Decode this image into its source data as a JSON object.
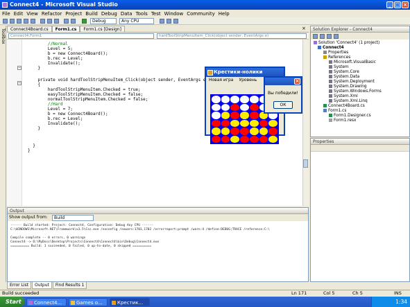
{
  "window": {
    "title": "Connect4 - Microsoft Visual Studio"
  },
  "menu": [
    "File",
    "Edit",
    "View",
    "Refactor",
    "Project",
    "Build",
    "Debug",
    "Data",
    "Tools",
    "Test",
    "Window",
    "Community",
    "Help"
  ],
  "toolbar": {
    "config": "Debug",
    "platform": "Any CPU"
  },
  "left_tab": "Toolbox",
  "doc_tabs": [
    "Connect4Board.cs",
    "Form1.cs",
    "Form1.cs [Design]"
  ],
  "nav": {
    "class": "Connect4.Form1",
    "member": "hardToolStripMenuItem_Click(object sender, EventArgs e)"
  },
  "code_lines": [
    "        //Normal",
    "        Level = 5;",
    "        b = new Connect4Board();",
    "        b.rec = Level;",
    "        Invalidate();",
    "    }",
    "",
    "    private void hardToolStripMenuItem_Click(object sender, EventArgs e)",
    "    {",
    "        hardToolStripMenuItem.Checked = true;",
    "        easyToolStripMenuItem.Checked = false;",
    "        normalToolStripMenuItem.Checked = false;",
    "        //Hard",
    "        Level = 7;",
    "        b = new Connect4Board();",
    "        b.rec = Level;",
    "        Invalidate();",
    "    }",
    "",
    "  }",
    "}"
  ],
  "solution_explorer": {
    "title": "Solution Explorer - Connect4",
    "nodes": [
      "Solution 'Connect4' (1 project)",
      "Connect4",
      "Properties",
      "References",
      "Microsoft.VisualBasic",
      "System",
      "System.Core",
      "System.Data",
      "System.Deployment",
      "System.Drawing",
      "System.Windows.Forms",
      "System.Xml",
      "System.Xml.Linq",
      "Connect4Board.cs",
      "Form1.cs",
      "Form1.Designer.cs",
      "Form1.resx"
    ]
  },
  "properties": {
    "title": "Properties"
  },
  "game_window": {
    "title": "Крестики-нолики",
    "menu": [
      "Новая игра",
      "Уровень"
    ],
    "board": [
      [
        "white",
        "white",
        "white",
        "white",
        "white",
        "white",
        "white"
      ],
      [
        "white",
        "white",
        "red",
        "white",
        "red",
        "white",
        "white"
      ],
      [
        "white",
        "yellow",
        "red",
        "yellow",
        "red",
        "yellow",
        "white"
      ],
      [
        "red",
        "red",
        "yellow",
        "yellow",
        "yellow",
        "red",
        "yellow"
      ],
      [
        "yellow",
        "yellow",
        "red",
        "red",
        "yellow",
        "yellow",
        "red"
      ],
      [
        "red",
        "red",
        "yellow",
        "red",
        "red",
        "red",
        "yellow"
      ]
    ]
  },
  "message_box": {
    "text": "Вы победили!",
    "ok": "ОК"
  },
  "output": {
    "title": "Output",
    "show_label": "Show output from:",
    "source": "Build",
    "lines": [
      "------ Build started: Project: Connect4, Configuration: Debug Any CPU ------",
      "C:\\WINDOWS\\Microsoft.NET\\Framework\\v3.5\\Csc.exe /noconfig /nowarn:1701,1702 /errorreport:prompt /warn:4 /define:DEBUG;TRACE /reference:C:\\",
      "",
      "Compile complete -- 0 errors, 0 warnings",
      "Connect4 -> D:\\MyDocs\\Desktop\\Projects\\Connect4\\Connect4\\bin\\Debug\\Connect4.exe",
      "========== Build: 1 succeeded, 0 failed, 0 up-to-date, 0 skipped =========="
    ]
  },
  "bottom_tabs": [
    "Error List",
    "Output",
    "Find Results 1"
  ],
  "status": {
    "message": "Build succeeded",
    "ln": "Ln 171",
    "col": "Col 5",
    "ch": "Ch 5",
    "mode": "INS"
  },
  "taskbar": {
    "start": "Start",
    "tasks": [
      "Connect4...",
      "Games o...",
      "Крестик..."
    ],
    "clock": "1:34"
  }
}
